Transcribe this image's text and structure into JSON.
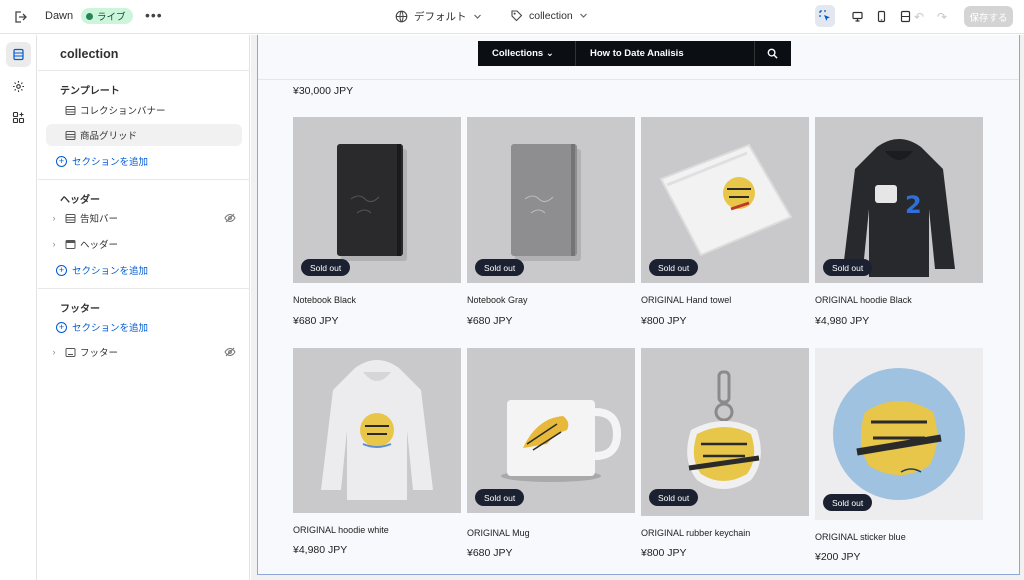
{
  "topbar": {
    "theme_name": "Dawn",
    "live_badge": "ライブ",
    "more": "•••",
    "view_label": "デフォルト",
    "template_label": "collection",
    "save_label": "保存する"
  },
  "sidebar": {
    "title": "collection",
    "template_heading": "テンプレート",
    "template_items": [
      "コレクションバナー",
      "商品グリッド"
    ],
    "add_section": "セクションを追加",
    "header_heading": "ヘッダー",
    "header_items": [
      "告知バー",
      "ヘッダー"
    ],
    "footer_heading": "フッター",
    "footer_items": [
      "フッター"
    ]
  },
  "preview": {
    "nav": {
      "item1": "Collections",
      "item2": "How to Date Analisis"
    },
    "top_price": "¥30,000 JPY",
    "sold_out": "Sold out",
    "products": [
      {
        "name": "Notebook Black",
        "price": "¥680 JPY"
      },
      {
        "name": "Notebook Gray",
        "price": "¥680 JPY"
      },
      {
        "name": "ORIGINAL Hand towel",
        "price": "¥800 JPY"
      },
      {
        "name": "ORIGINAL hoodie Black",
        "price": "¥4,980 JPY"
      },
      {
        "name": "ORIGINAL hoodie white",
        "price": "¥4,980 JPY"
      },
      {
        "name": "ORIGINAL Mug",
        "price": "¥680 JPY"
      },
      {
        "name": "ORIGINAL rubber keychain",
        "price": "¥800 JPY"
      },
      {
        "name": "ORIGINAL sticker blue",
        "price": "¥200 JPY"
      }
    ]
  }
}
